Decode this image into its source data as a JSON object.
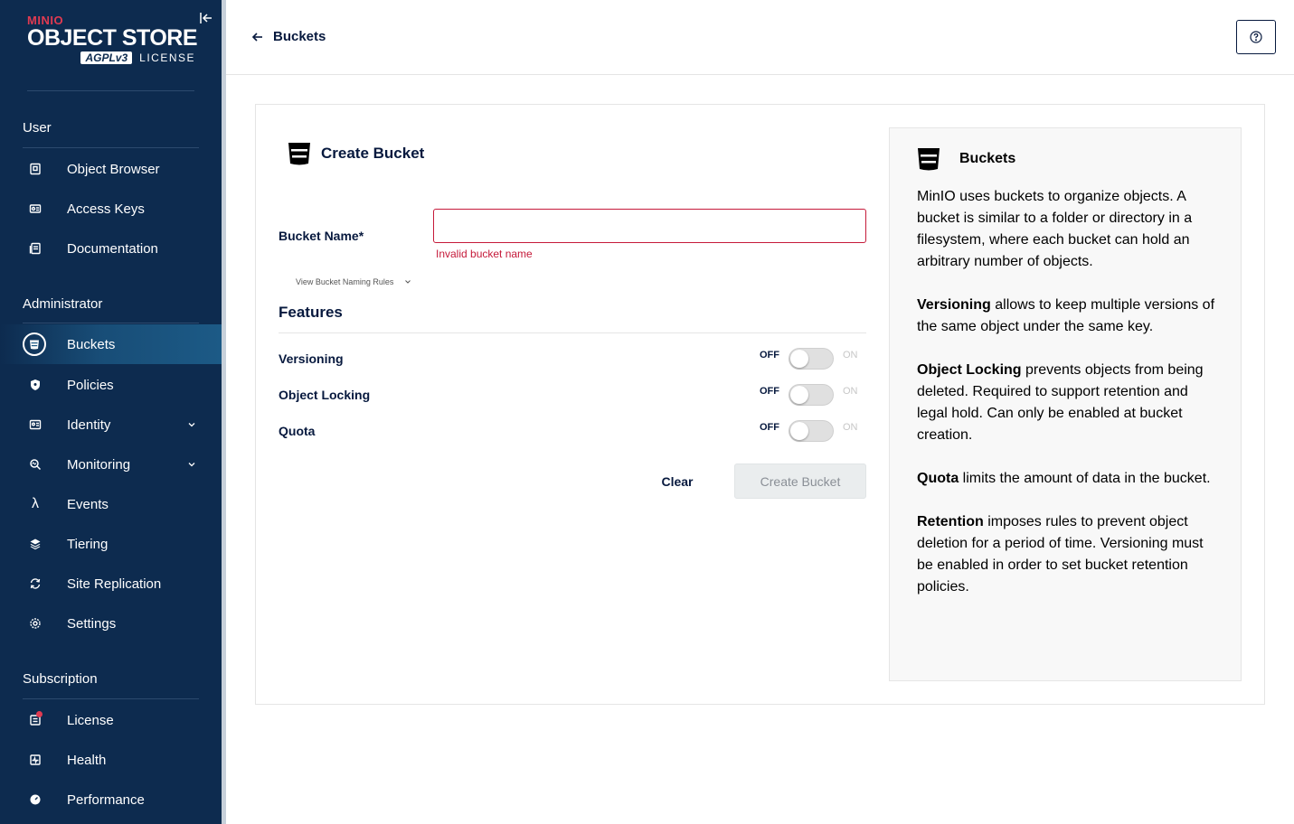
{
  "sidebar": {
    "logo": {
      "brand": "MINIO",
      "product": "OBJECT STORE",
      "agpl": "AGPLv3",
      "license": "LICENSE"
    },
    "sections": {
      "user": "User",
      "administrator": "Administrator",
      "subscription": "Subscription"
    },
    "items": {
      "object_browser": "Object Browser",
      "access_keys": "Access Keys",
      "documentation": "Documentation",
      "buckets": "Buckets",
      "policies": "Policies",
      "identity": "Identity",
      "monitoring": "Monitoring",
      "events": "Events",
      "tiering": "Tiering",
      "site_replication": "Site Replication",
      "settings": "Settings",
      "license": "License",
      "health": "Health",
      "performance": "Performance"
    },
    "active_item": "buckets",
    "badge_color": "#e03a51"
  },
  "header": {
    "back_label": "Buckets",
    "help_icon": "question-circle-icon"
  },
  "form": {
    "title": "Create Bucket",
    "bucket_name_label": "Bucket Name*",
    "bucket_name_value": "",
    "bucket_name_error": "Invalid bucket name",
    "naming_rules_link": "View Bucket Naming Rules",
    "features_title": "Features",
    "features": {
      "versioning": {
        "label": "Versioning",
        "off": "OFF",
        "on": "ON",
        "enabled": false
      },
      "object_locking": {
        "label": "Object Locking",
        "off": "OFF",
        "on": "ON",
        "enabled": false
      },
      "quota": {
        "label": "Quota",
        "off": "OFF",
        "on": "ON",
        "enabled": false
      }
    },
    "clear_label": "Clear",
    "create_label": "Create Bucket",
    "error_color": "#c51a3a"
  },
  "help": {
    "title": "Buckets",
    "intro": "MinIO uses buckets to organize objects. A bucket is similar to a folder or directory in a filesystem, where each bucket can hold an arbitrary number of objects.",
    "versioning_term": "Versioning",
    "versioning_text": " allows to keep multiple versions of the same object under the same key.",
    "locking_term": "Object Locking",
    "locking_text": " prevents objects from being deleted. Required to support retention and legal hold. Can only be enabled at bucket creation.",
    "quota_term": "Quota",
    "quota_text": " limits the amount of data in the bucket.",
    "retention_term": "Retention",
    "retention_text": " imposes rules to prevent object deletion for a period of time. Versioning must be enabled in order to set bucket retention policies."
  }
}
